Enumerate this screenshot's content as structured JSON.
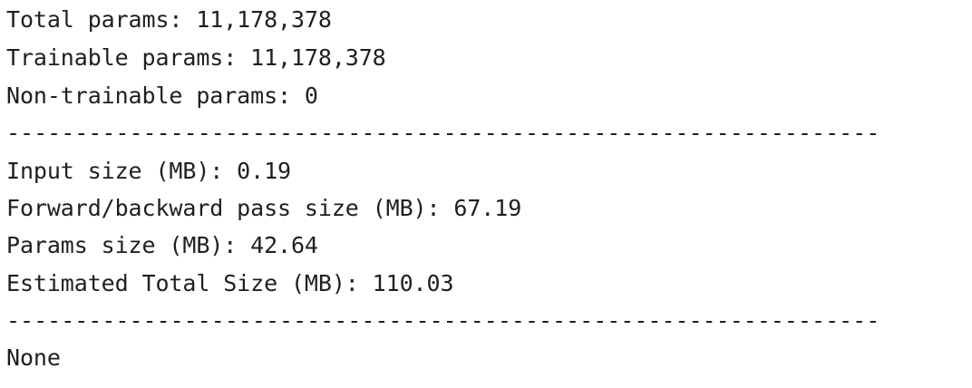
{
  "console": {
    "lines": [
      "Total params: 11,178,378",
      "Trainable params: 11,178,378",
      "Non-trainable params: 0",
      "----------------------------------------------------------------",
      "Input size (MB): 0.19",
      "Forward/backward pass size (MB): 67.19",
      "Params size (MB): 42.64",
      "Estimated Total Size (MB): 110.03",
      "----------------------------------------------------------------",
      "None"
    ]
  }
}
